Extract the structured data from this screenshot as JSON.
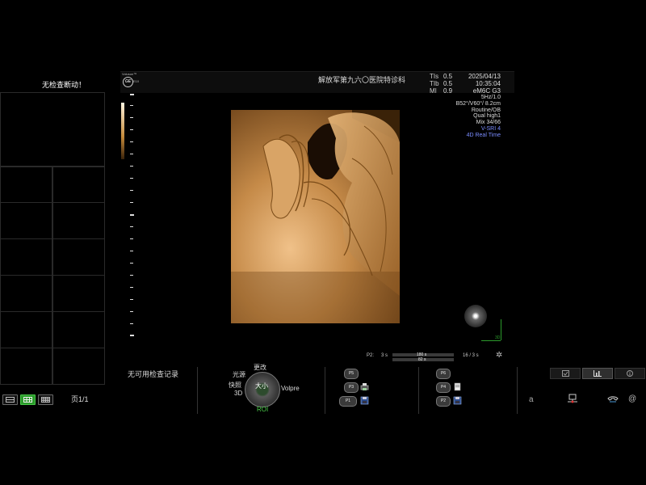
{
  "left_panel": {
    "title": "无检查断动！",
    "page_indicator": "页1/1",
    "layout_buttons": [
      "layout-2x1",
      "layout-3x2",
      "layout-4x3"
    ]
  },
  "header": {
    "logo_brand": "Voluson™",
    "logo_ge": "GE",
    "probe_small": "E10",
    "hospital": "解放军第九六〇医院特诊科",
    "params": [
      {
        "label": "TIs",
        "value": "0.5"
      },
      {
        "label": "TIb",
        "value": "0.5"
      },
      {
        "label": "MI",
        "value": "0.9"
      }
    ],
    "date": "2025/04/13",
    "time": "10:35:04",
    "probe": "eM6C G3"
  },
  "image_info": {
    "lines": [
      "5Hz/1.0",
      "B52°/V60°/ 8.2cm",
      "Routine/OB",
      "Qual high1",
      "Mix 34/66"
    ],
    "blue_lines": [
      "V-SRI 4",
      "4D Real Time"
    ]
  },
  "orientation": {
    "label": "3D"
  },
  "cine": {
    "label": "P2:",
    "speed": "3 s",
    "bar1_text": "180 s",
    "bar2_text": "82 s",
    "frame": "16 / 3 s"
  },
  "bottom": {
    "no_records": "无可用检查记录",
    "trackball": {
      "center": "大小",
      "top": "更改",
      "top_left": "光源",
      "left": "快照",
      "left2": "3D",
      "right": "Volpre",
      "bottom": "ROI"
    },
    "p_buttons_left": [
      "P5",
      "P3",
      "P1"
    ],
    "p_buttons_right": [
      "P6",
      "P4",
      "P2"
    ]
  },
  "right_bottom": {
    "letter": "a",
    "at": "@"
  },
  "colors": {
    "accent_green": "#49c649",
    "info_blue": "#7a8cff",
    "image_sepia": "#b07a3a"
  }
}
